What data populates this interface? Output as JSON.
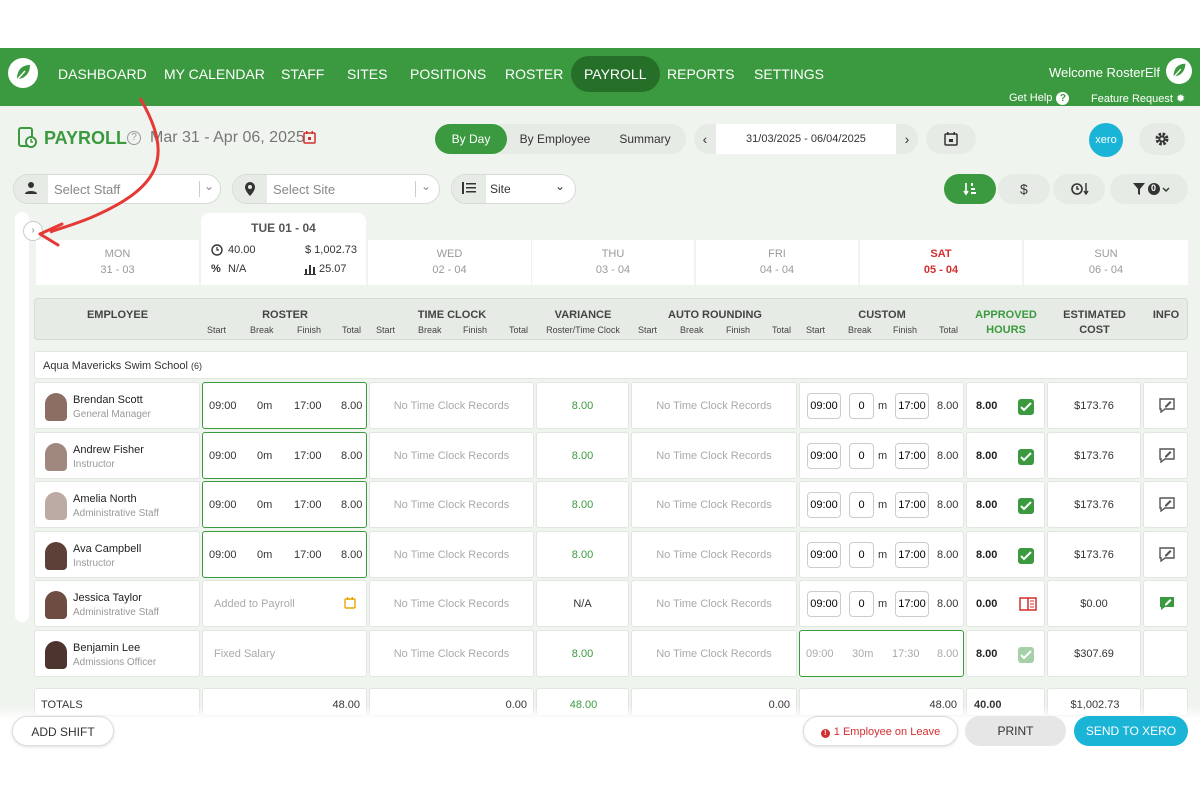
{
  "nav": {
    "items": [
      "DASHBOARD",
      "MY CALENDAR",
      "STAFF",
      "SITES",
      "POSITIONS",
      "ROSTER",
      "PAYROLL",
      "REPORTS",
      "SETTINGS"
    ],
    "active": "PAYROLL",
    "welcome": "Welcome RosterElf",
    "help": "Get Help",
    "feature": "Feature Request"
  },
  "page": {
    "title": "PAYROLL",
    "range": "Mar 31 - Apr 06, 2025",
    "view_tabs": [
      "By Day",
      "By Employee",
      "Summary"
    ],
    "active_view": "By Day",
    "date_range": "31/03/2025 - 06/04/2025",
    "xero_label": "xero"
  },
  "filters": {
    "staff_placeholder": "Select Staff",
    "site_placeholder": "Select Site",
    "group_by": "Site",
    "filter_count": "0"
  },
  "days": [
    {
      "name": "MON",
      "date": "31 - 03"
    },
    {
      "name": "TUE 01 - 04",
      "date": ""
    },
    {
      "name": "WED",
      "date": "02 - 04"
    },
    {
      "name": "THU",
      "date": "03 - 04"
    },
    {
      "name": "FRI",
      "date": "04 - 04"
    },
    {
      "name": "SAT",
      "date": "05 - 04"
    },
    {
      "name": "SUN",
      "date": "06 - 04"
    }
  ],
  "today_stats": {
    "hours": "40.00",
    "cost": "$ 1,002.73",
    "pct": "N/A",
    "avg": "25.07"
  },
  "headers": {
    "employee": "EMPLOYEE",
    "roster": "ROSTER",
    "timeclock": "TIME CLOCK",
    "variance": "VARIANCE",
    "variance_sub": "Roster/Time Clock",
    "auto": "AUTO ROUNDING",
    "custom": "CUSTOM",
    "approved1": "APPROVED",
    "approved2": "HOURS",
    "cost1": "ESTIMATED",
    "cost2": "COST",
    "info": "INFO",
    "start": "Start",
    "break": "Break",
    "finish": "Finish",
    "total": "Total"
  },
  "group": {
    "name": "Aqua Mavericks Swim School",
    "count": "(6)"
  },
  "no_records": "No Time Clock Records",
  "rows": [
    {
      "name": "Brendan Scott",
      "role": "General Manager",
      "r_start": "09:00",
      "r_break": "0m",
      "r_finish": "17:00",
      "r_total": "8.00",
      "variance": "8.00",
      "c_start": "09:00",
      "c_break": "0",
      "c_finish": "17:00",
      "c_total": "8.00",
      "hours": "8.00",
      "cost": "$173.76"
    },
    {
      "name": "Andrew Fisher",
      "role": "Instructor",
      "r_start": "09:00",
      "r_break": "0m",
      "r_finish": "17:00",
      "r_total": "8.00",
      "variance": "8.00",
      "c_start": "09:00",
      "c_break": "0",
      "c_finish": "17:00",
      "c_total": "8.00",
      "hours": "8.00",
      "cost": "$173.76"
    },
    {
      "name": "Amelia North",
      "role": "Administrative Staff",
      "r_start": "09:00",
      "r_break": "0m",
      "r_finish": "17:00",
      "r_total": "8.00",
      "variance": "8.00",
      "c_start": "09:00",
      "c_break": "0",
      "c_finish": "17:00",
      "c_total": "8.00",
      "hours": "8.00",
      "cost": "$173.76"
    },
    {
      "name": "Ava Campbell",
      "role": "Instructor",
      "r_start": "09:00",
      "r_break": "0m",
      "r_finish": "17:00",
      "r_total": "8.00",
      "variance": "8.00",
      "c_start": "09:00",
      "c_break": "0",
      "c_finish": "17:00",
      "c_total": "8.00",
      "hours": "8.00",
      "cost": "$173.76"
    },
    {
      "name": "Jessica Taylor",
      "role": "Administrative Staff",
      "r_text": "Added to Payroll",
      "variance": "N/A",
      "c_start": "09:00",
      "c_break": "0",
      "c_finish": "17:00",
      "c_total": "8.00",
      "hours": "0.00",
      "cost": "$0.00"
    },
    {
      "name": "Benjamin Lee",
      "role": "Admissions Officer",
      "r_text": "Fixed Salary",
      "variance": "8.00",
      "c_start": "09:00",
      "c_break": "30m",
      "c_finish": "17:30",
      "c_total": "8.00",
      "hours": "8.00",
      "cost": "$307.69"
    }
  ],
  "totals": {
    "label": "TOTALS",
    "roster": "48.00",
    "timeclock": "0.00",
    "variance": "48.00",
    "auto": "0.00",
    "custom": "48.00",
    "hours": "40.00",
    "cost": "$1,002.73"
  },
  "bottom": {
    "add_shift": "ADD SHIFT",
    "leave": "1 Employee on Leave",
    "print": "PRINT",
    "send": "SEND TO XERO"
  },
  "colors": {
    "brand": "#3b9a3f",
    "brand_dark": "#256f29",
    "xero": "#1ab4d7",
    "alert": "#d32f2f"
  }
}
